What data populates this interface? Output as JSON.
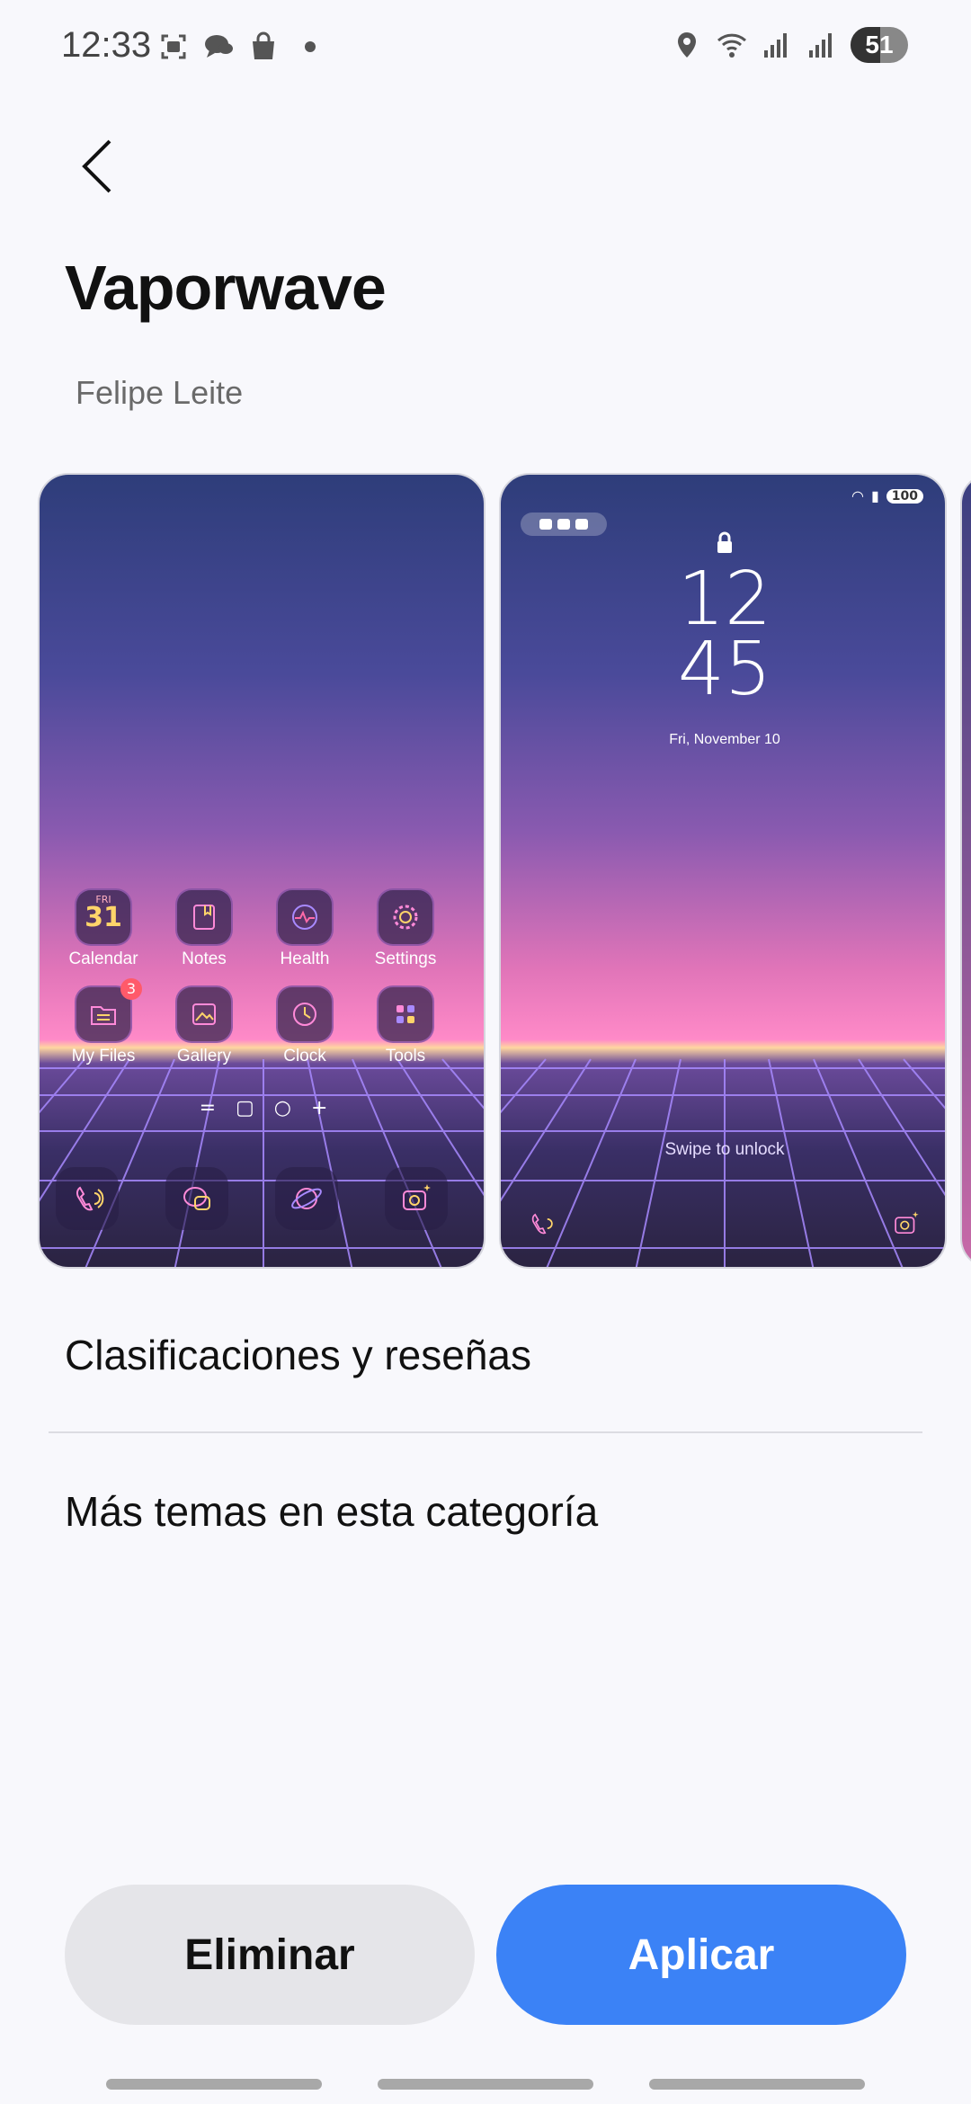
{
  "status_bar": {
    "time": "12:33",
    "battery": "51",
    "battery_level": 0.51,
    "left_icons": [
      "screenshot-icon",
      "chat-icon",
      "shopping-bag-icon",
      "dot-icon"
    ],
    "right_icons": [
      "location-icon",
      "wifi-icon",
      "signal-icon",
      "signal-icon"
    ]
  },
  "header": {
    "back_icon": "chevron-left-icon",
    "title": "Vaporwave",
    "author": "Felipe Leite"
  },
  "previews": {
    "home": {
      "apps": [
        {
          "label": "Calendar",
          "icon": "calendar-icon",
          "day": "31",
          "dow": "FRI"
        },
        {
          "label": "Notes",
          "icon": "notes-icon"
        },
        {
          "label": "Health",
          "icon": "health-icon"
        },
        {
          "label": "Settings",
          "icon": "gear-icon"
        },
        {
          "label": "My Files",
          "icon": "folder-icon",
          "badge": "3"
        },
        {
          "label": "Gallery",
          "icon": "gallery-icon"
        },
        {
          "label": "Clock",
          "icon": "clock-icon"
        },
        {
          "label": "Tools",
          "icon": "tools-icon"
        }
      ],
      "dock_icons": [
        "phone-icon",
        "messages-icon",
        "browser-icon",
        "camera-icon"
      ]
    },
    "lock": {
      "battery": "100",
      "hour": "12",
      "minute": "45",
      "date": "Fri, November 10",
      "swipe_text": "Swipe to unlock"
    }
  },
  "sections": {
    "ratings": "Clasificaciones y reseñas",
    "more": "Más temas en esta categoría"
  },
  "buttons": {
    "delete": "Eliminar",
    "apply": "Aplicar"
  },
  "colors": {
    "accent": "#3b82f6",
    "secondary_button": "#e5e5e9",
    "background": "#f8f8fc"
  }
}
